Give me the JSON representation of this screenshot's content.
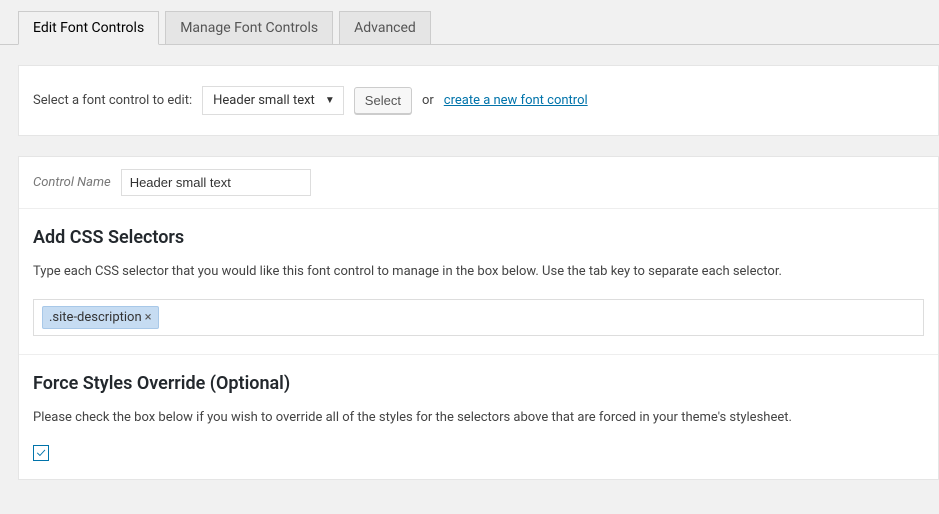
{
  "tabs": {
    "edit": "Edit Font Controls",
    "manage": "Manage Font Controls",
    "advanced": "Advanced"
  },
  "selector_panel": {
    "label": "Select a font control to edit:",
    "selected": "Header small text",
    "select_btn": "Select",
    "or_text": "or",
    "create_link": "create a new font control"
  },
  "control_name": {
    "label": "Control Name",
    "value": "Header small text"
  },
  "css_selectors": {
    "title": "Add CSS Selectors",
    "description": "Type each CSS selector that you would like this font control to manage in the box below. Use the tab key to separate each selector.",
    "tags": [
      ".site-description"
    ]
  },
  "force_override": {
    "title": "Force Styles Override (Optional)",
    "description": "Please check the box below if you wish to override all of the styles for the selectors above that are forced in your theme's stylesheet.",
    "checked": true
  }
}
